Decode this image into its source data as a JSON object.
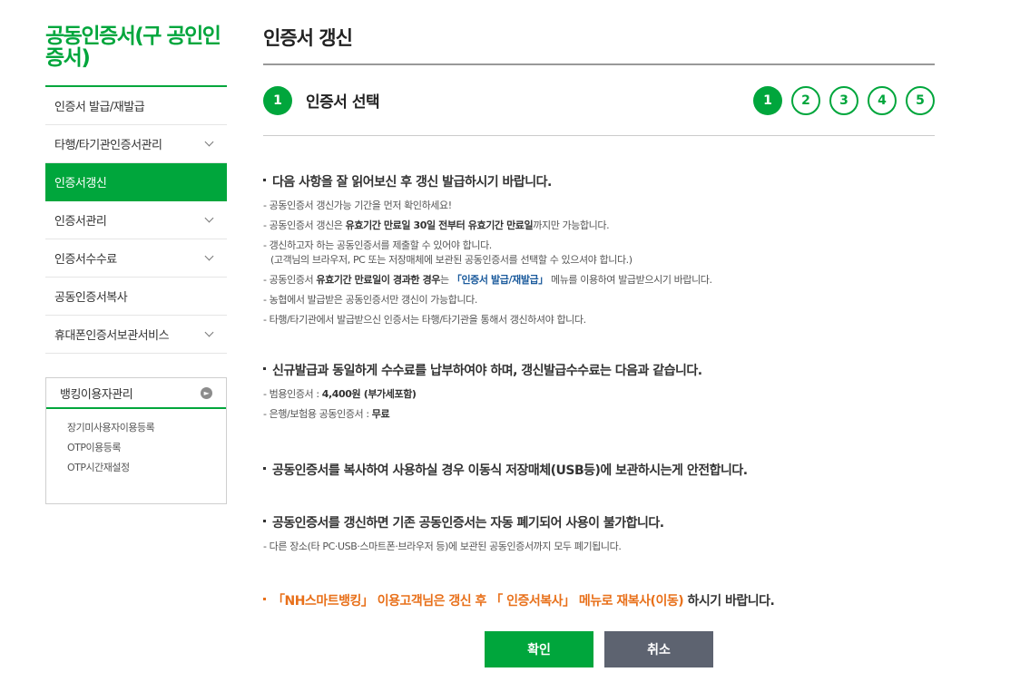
{
  "sidebar": {
    "title": "공동인증서(구 공인인증서)",
    "menu": [
      {
        "label": "인증서 발급/재발급",
        "chevron": false,
        "active": false
      },
      {
        "label": "타행/타기관인증서관리",
        "chevron": true,
        "active": false
      },
      {
        "label": "인증서갱신",
        "chevron": false,
        "active": true
      },
      {
        "label": "인증서관리",
        "chevron": true,
        "active": false
      },
      {
        "label": "인증서수수료",
        "chevron": true,
        "active": false
      },
      {
        "label": "공동인증서복사",
        "chevron": false,
        "active": false
      },
      {
        "label": "휴대폰인증서보관서비스",
        "chevron": true,
        "active": false
      }
    ],
    "banking": {
      "title": "뱅킹이용자관리",
      "items": [
        "장기미사용자이용등록",
        "OTP이용등록",
        "OTP시간재설정"
      ]
    }
  },
  "main": {
    "page_title": "인증서 갱신",
    "current_step_number": "1",
    "current_step_label": "인증서 선택",
    "steps": [
      "1",
      "2",
      "3",
      "4",
      "5"
    ],
    "sections": {
      "s1": {
        "title": "다음 사항을 잘 읽어보신 후 갱신 발급하시기 바랍니다.",
        "n1": "- 공동인증서 갱신가능 기간을 먼저 확인하세요!",
        "n2_a": "- 공동인증서 갱신은 ",
        "n2_b": "유효기간 만료일 30일 전부터 유효기간 만료일",
        "n2_c": "까지만 가능합니다.",
        "n3_a": "- 갱신하고자 하는 공동인증서를 제출할 수 있어야 합니다.",
        "n3_b": "(고객님의 브라우저, PC 또는 저장매체에 보관된 공동인증서를 선택할 수 있으셔야 합니다.)",
        "n4_a": "- 공동인증서 ",
        "n4_b": "유효기간 만료일이 경과한 경우",
        "n4_c": "는 ",
        "n4_link": "「인증서 발급/재발급」",
        "n4_d": "메뉴를 이용하여 발급받으시기 바랍니다.",
        "n5": "- 농협에서 발급받은 공동인증서만 갱신이 가능합니다.",
        "n6": "- 타행/타기관에서 발급받으신 인증서는 타행/타기관을 통해서 갱신하셔야 합니다."
      },
      "s2": {
        "title": "신규발급과 동일하게 수수료를 납부하여야 하며, 갱신발급수수료는 다음과 같습니다.",
        "n1_a": "- 범용인증서 : ",
        "n1_b": "4,400원 (부가세포함)",
        "n2_a": "- 은행/보험용 공동인증서 : ",
        "n2_b": "무료"
      },
      "s3": {
        "title": "공동인증서를 복사하여 사용하실 경우 이동식 저장매체(USB등)에 보관하시는게 안전합니다."
      },
      "s4": {
        "title": "공동인증서를 갱신하면 기존 공동인증서는 자동 폐기되어 사용이 불가합니다.",
        "n1": "- 다른 장소(타 PC·USB·스마트폰·브라우저 등)에 보관된 공동인증서까지 모두 폐기됩니다."
      },
      "s5": {
        "part1": "「NH스마트뱅킹」 이용고객님은 갱신 후 「 인증서복사」 메뉴로 재복사(이동)",
        "part2": " 하시기 바랍니다."
      }
    },
    "buttons": {
      "confirm": "확인",
      "cancel": "취소"
    }
  },
  "colors": {
    "accent": "#00a63c",
    "orange": "#e8701a",
    "link": "#1a5a9c",
    "cancel_button": "#5d6370"
  },
  "icons": {
    "chevron": "chevron-down-icon",
    "banking_arrow": "arrow-right-circle-icon"
  }
}
